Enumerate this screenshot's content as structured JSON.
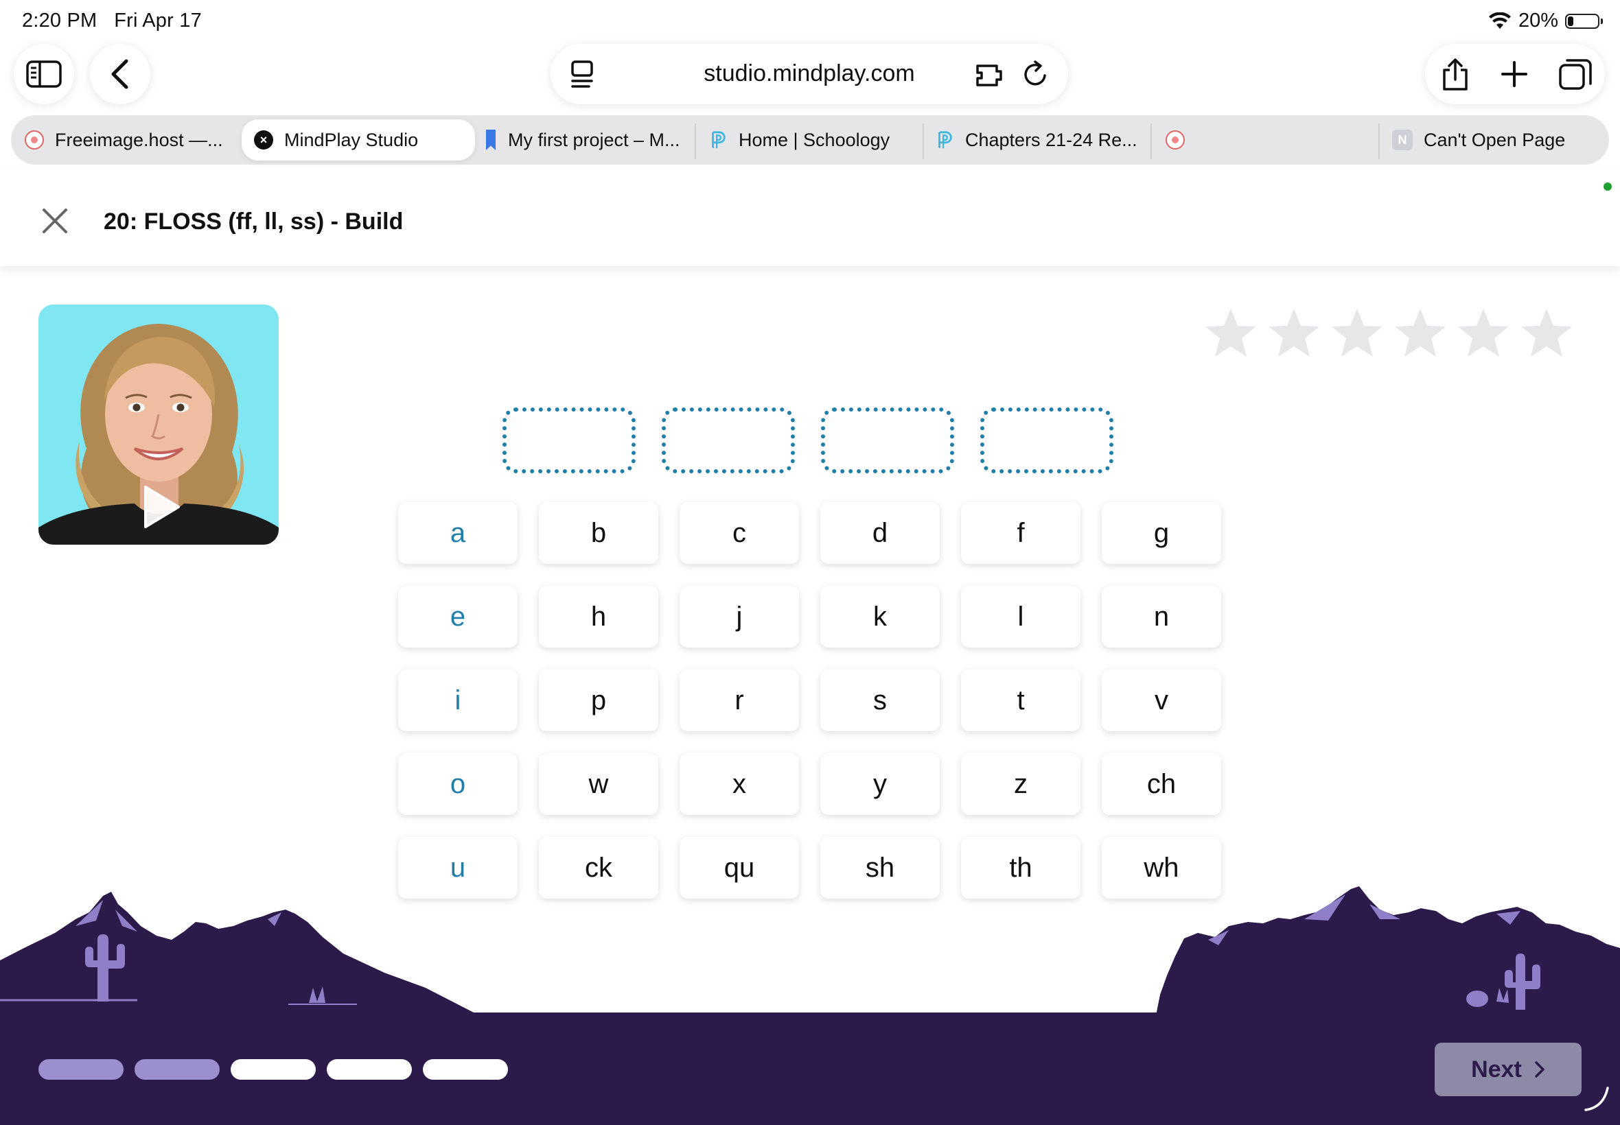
{
  "status_bar": {
    "time": "2:20 PM",
    "date": "Fri Apr 17",
    "battery": "20%",
    "battery_level": 0.2
  },
  "browser": {
    "url": "studio.mindplay.com",
    "tabs": [
      {
        "title": "Freeimage.host —...",
        "favicon": "image-icon"
      },
      {
        "title": "MindPlay Studio",
        "favicon": "close-icon",
        "active": true
      },
      {
        "title": "My first project – M...",
        "favicon": "bookmark-icon"
      },
      {
        "title": "Home | Schoology",
        "favicon": "schoology-icon"
      },
      {
        "title": "Chapters 21-24 Re...",
        "favicon": "schoology-icon"
      },
      {
        "title": "",
        "favicon": "image-icon"
      },
      {
        "title": "Can't Open Page",
        "favicon": "n-icon",
        "favicon_letter": "N"
      }
    ]
  },
  "lesson": {
    "title": "20: FLOSS (ff, ll, ss) - Build"
  },
  "rating": {
    "stars_total": 6,
    "stars_filled": 0
  },
  "slots": {
    "count": 4
  },
  "tiles": {
    "rows": [
      [
        "a",
        "b",
        "c",
        "d",
        "f",
        "g"
      ],
      [
        "e",
        "h",
        "j",
        "k",
        "l",
        "n"
      ],
      [
        "i",
        "p",
        "r",
        "s",
        "t",
        "v"
      ],
      [
        "o",
        "w",
        "x",
        "y",
        "z",
        "ch"
      ],
      [
        "u",
        "ck",
        "qu",
        "sh",
        "th",
        "wh"
      ]
    ],
    "vowel_color": "#1f7fa8"
  },
  "progress": {
    "segments": 5,
    "completed": 2,
    "done_color": "#9b8fd0",
    "todo_color": "#ffffff"
  },
  "footer": {
    "next_label": "Next",
    "background": "#2b1a4a"
  }
}
